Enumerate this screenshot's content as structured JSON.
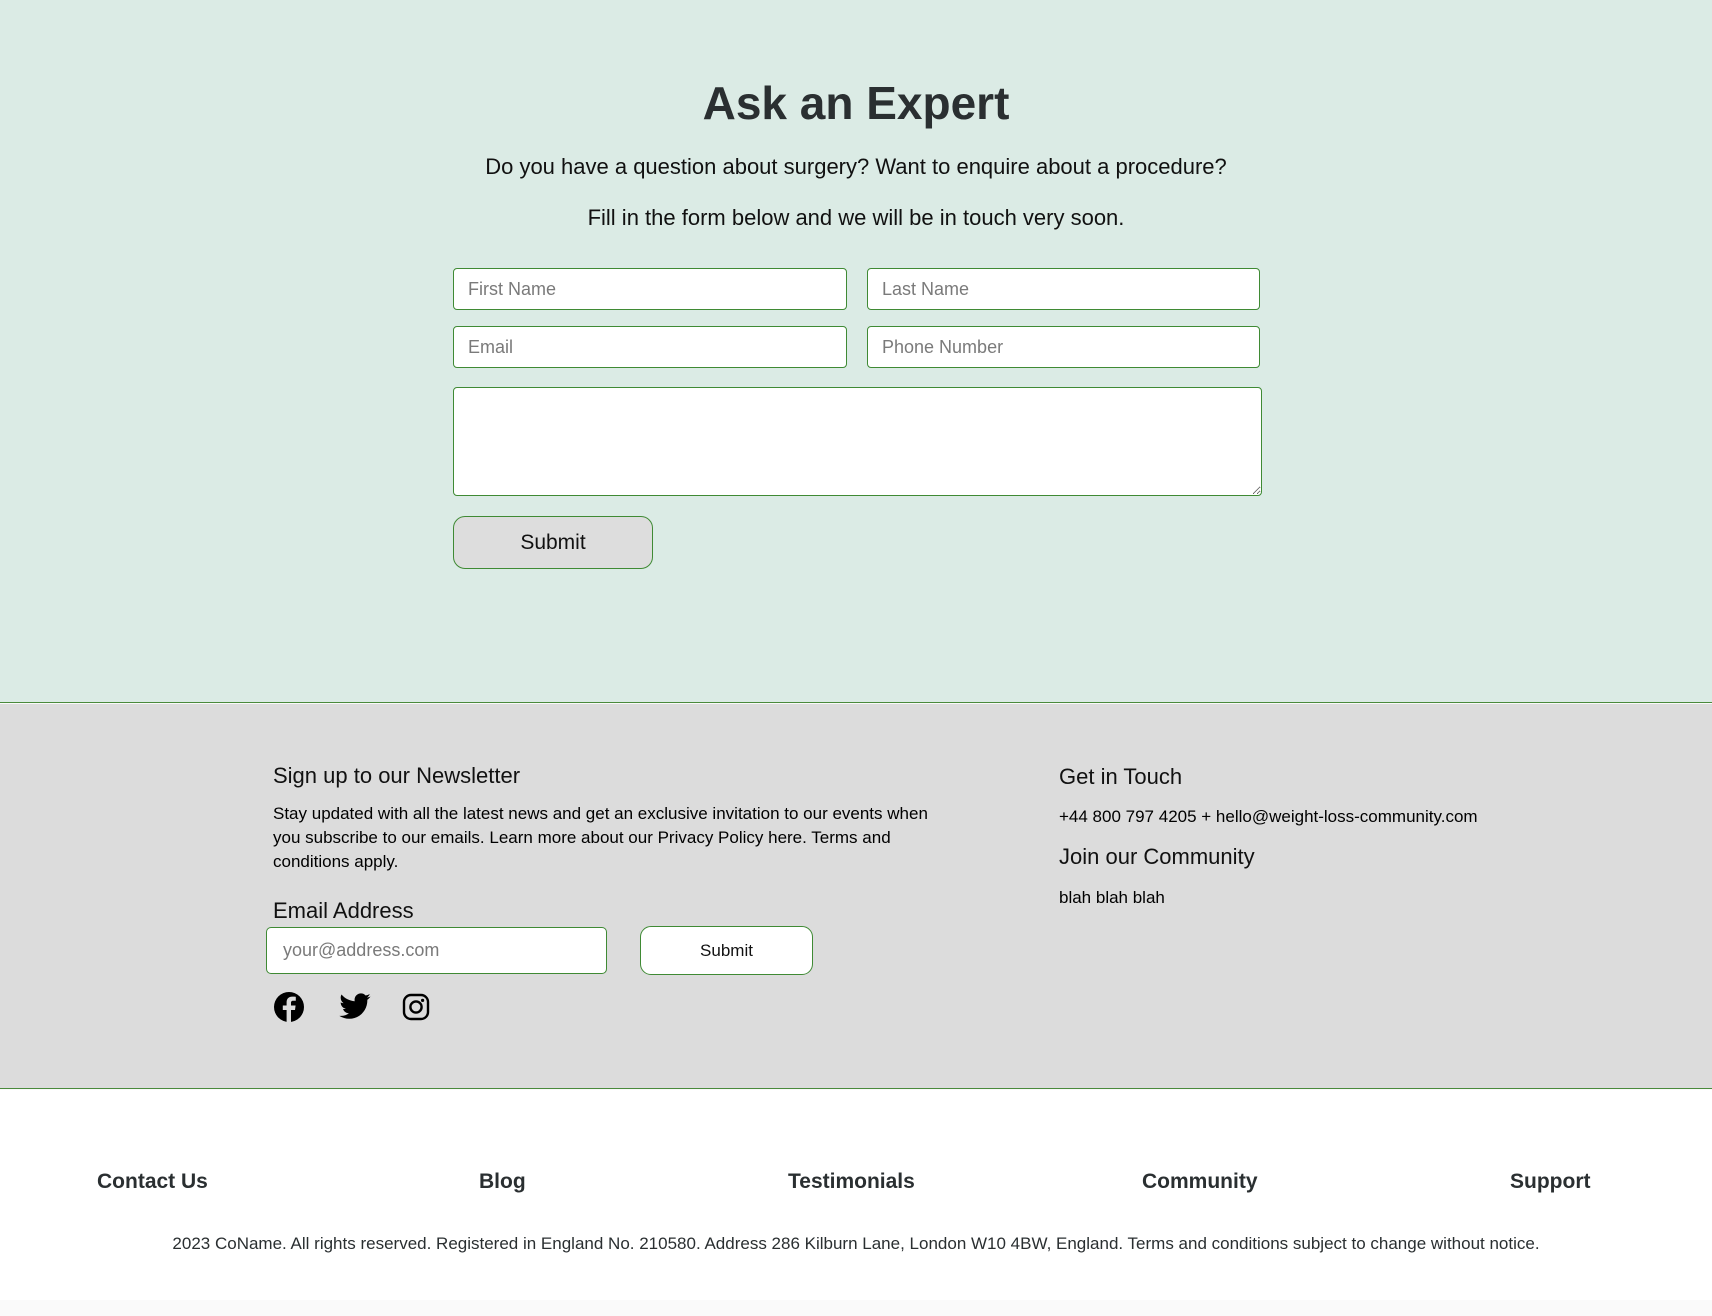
{
  "expert": {
    "title": "Ask an Expert",
    "lead1": "Do you have a question about surgery? Want to enquire about a procedure?",
    "lead2": "Fill in the form below and we will be in touch very soon.",
    "fields": {
      "first_name_placeholder": "First Name",
      "last_name_placeholder": "Last Name",
      "email_placeholder": "Email",
      "phone_placeholder": "Phone Number",
      "message_value": ""
    },
    "submit_label": "Submit"
  },
  "newsletter": {
    "title": "Sign up to our Newsletter",
    "text": "Stay updated with all the latest news and get an exclusive invitation to our events when you subscribe to our emails. Learn more about our Privacy Policy here. Terms and conditions apply.",
    "email_label": "Email Address",
    "email_placeholder": "your@address.com",
    "submit_label": "Submit",
    "social_icons": [
      "facebook-icon",
      "twitter-icon",
      "instagram-icon"
    ]
  },
  "contact": {
    "get_in_touch_title": "Get in Touch",
    "contact_line": "+44 800 797 4205 + hello@weight-loss-community.com",
    "community_title": "Join our Community",
    "community_text": "blah blah blah"
  },
  "footer": {
    "nav": [
      "Contact Us",
      "Blog",
      "Testimonials",
      "Community",
      "Support"
    ],
    "copyright": "2023 CoName. All rights reserved. Registered in England No. 210580. Address 286 Kilburn Lane, London W10 4BW, England. Terms and conditions subject to change without notice."
  },
  "colors": {
    "expert_bg": "#dbebe5",
    "newsletter_bg": "#dcdcdc",
    "accent_border": "#3f8a34",
    "heading_text": "#2a2f31"
  }
}
